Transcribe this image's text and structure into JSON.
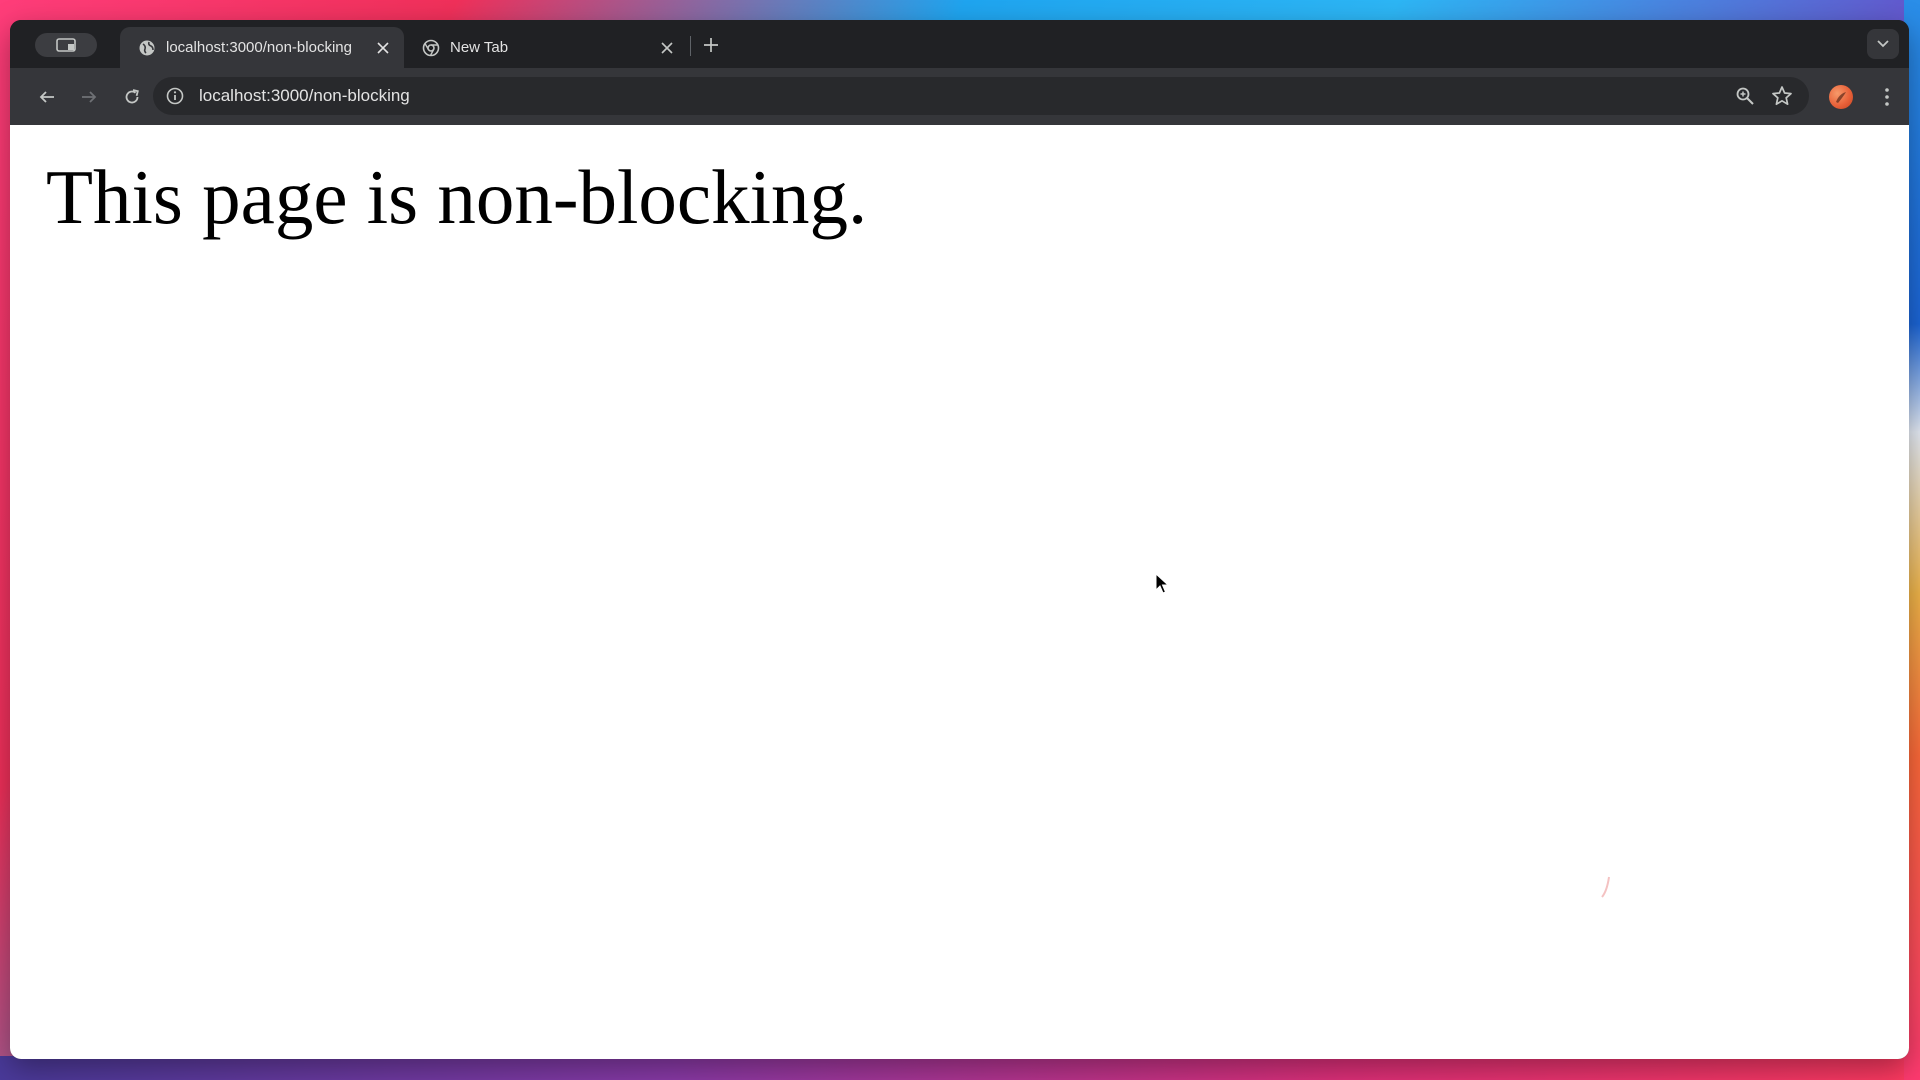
{
  "browser": {
    "tabs": [
      {
        "title": "localhost:3000/non-blocking",
        "active": true,
        "favicon": "globe-icon"
      },
      {
        "title": "New Tab",
        "active": false,
        "favicon": "chrome-icon"
      }
    ],
    "address_bar": {
      "url": "localhost:3000/non-blocking"
    },
    "icons": {
      "sidepanel": "tab-groups-icon",
      "close": "close-icon",
      "new_tab": "plus-icon",
      "tab_search": "chevron-down-icon",
      "back": "arrow-left-icon",
      "forward": "arrow-right-icon",
      "reload": "reload-icon",
      "site_info": "info-icon",
      "zoom": "zoom-icon",
      "bookmark": "star-icon",
      "profile": "avatar",
      "menu": "kebab-menu-icon"
    },
    "colors": {
      "frame": "#202124",
      "toolbar": "#35363a",
      "omnibox": "#28292c"
    }
  },
  "page": {
    "heading": "This page is non-blocking."
  }
}
